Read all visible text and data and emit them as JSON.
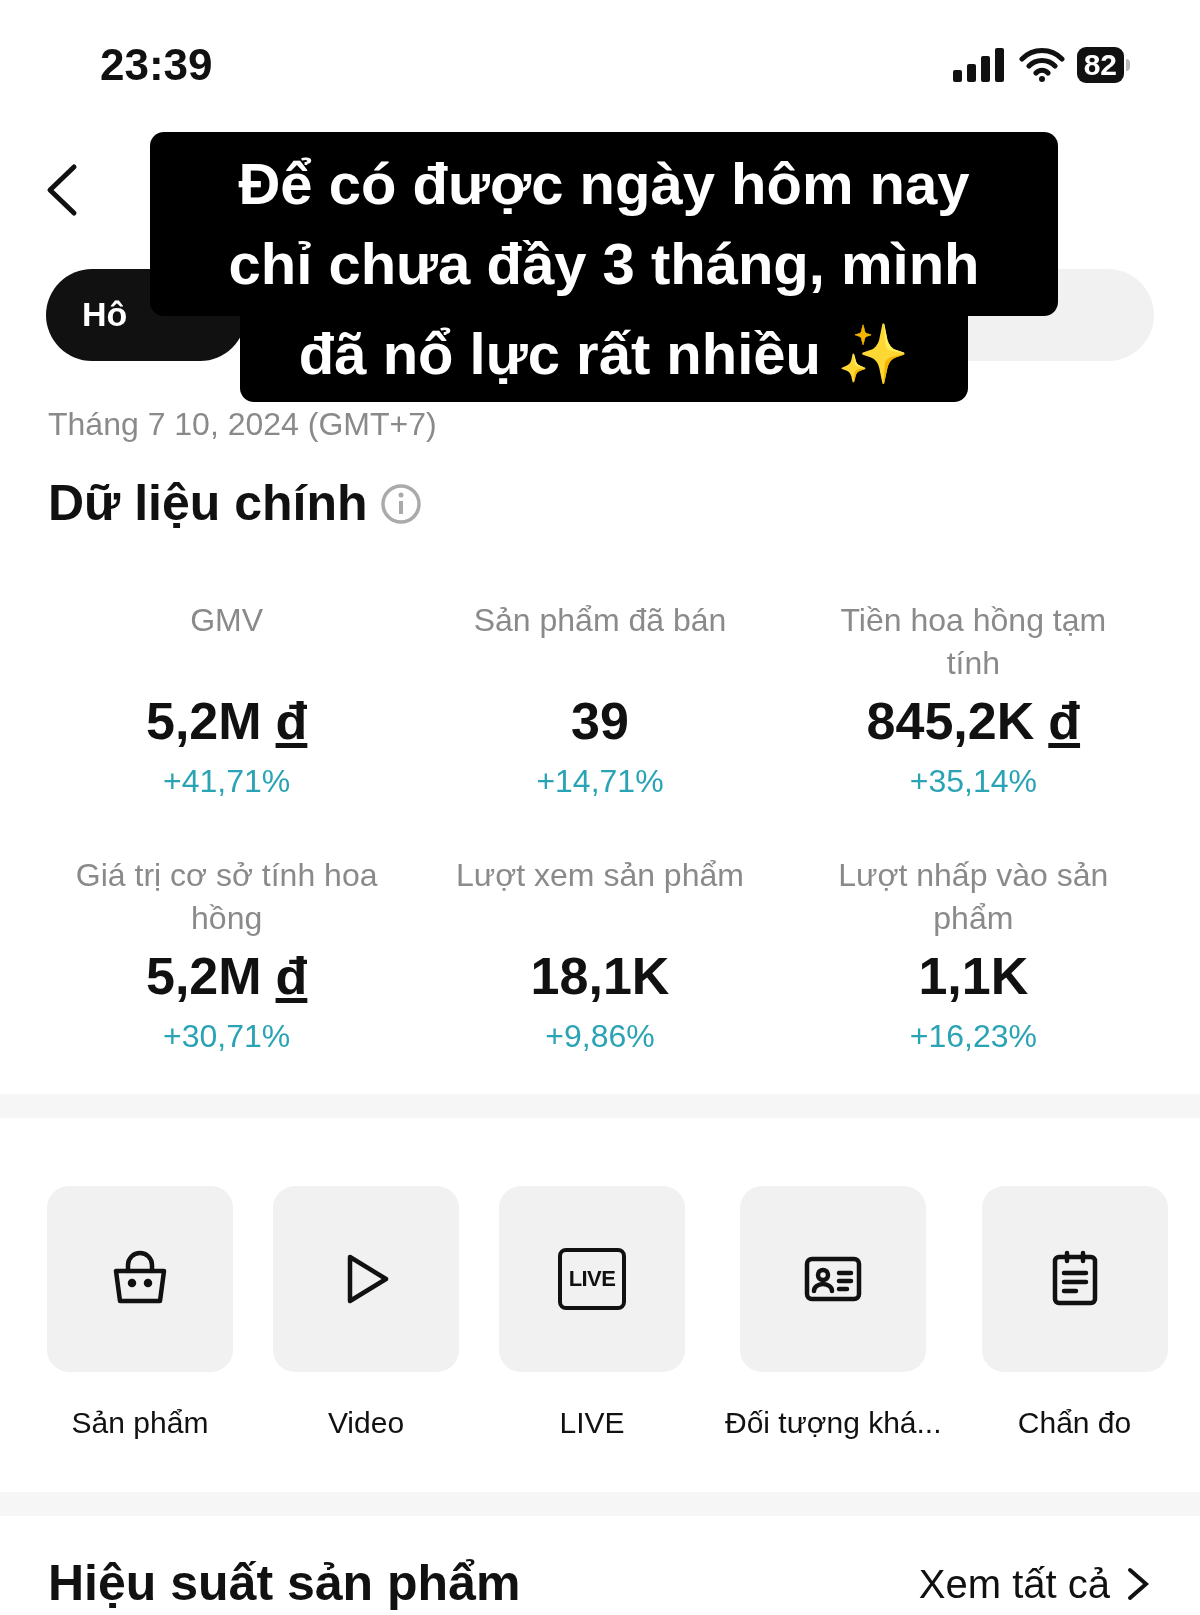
{
  "status_bar": {
    "time": "23:39",
    "battery": "82"
  },
  "caption": {
    "lines": [
      "Để có được ngày hôm nay",
      "chỉ chưa đầy 3 tháng, mình",
      "đã nổ lực rất nhiều ✨"
    ]
  },
  "tabs": [
    {
      "label": "Hô",
      "selected": true
    },
    {
      "selected": false
    }
  ],
  "date": "Tháng 7 10, 2024 (GMT+7)",
  "main_data": {
    "title": "Dữ liệu chính",
    "metrics": [
      {
        "label": "GMV",
        "value": "5,2M",
        "currency": "đ",
        "change": "+41,71%"
      },
      {
        "label": "Sản phẩm đã bán",
        "value": "39",
        "change": "+14,71%"
      },
      {
        "label": "Tiền hoa hồng tạm tính",
        "value": "845,2K",
        "currency": "đ",
        "change": "+35,14%"
      },
      {
        "label": "Giá trị cơ sở tính hoa hồng",
        "value": "5,2M",
        "currency": "đ",
        "change": "+30,71%"
      },
      {
        "label": "Lượt xem sản phẩm",
        "value": "18,1K",
        "change": "+9,86%"
      },
      {
        "label": "Lượt nhấp vào sản phẩm",
        "value": "1,1K",
        "change": "+16,23%"
      }
    ]
  },
  "shortcuts": [
    {
      "kind": "bag",
      "label": "Sản phẩm"
    },
    {
      "kind": "play",
      "label": "Video"
    },
    {
      "kind": "live",
      "label": "LIVE",
      "icon_text": "LIVE"
    },
    {
      "kind": "card",
      "label": "Đối tượng khá..."
    },
    {
      "kind": "clipboard",
      "label": "Chẩn đo"
    }
  ],
  "product_performance": {
    "title": "Hiệu suất sản phẩm",
    "link": "Xem tất cả"
  }
}
